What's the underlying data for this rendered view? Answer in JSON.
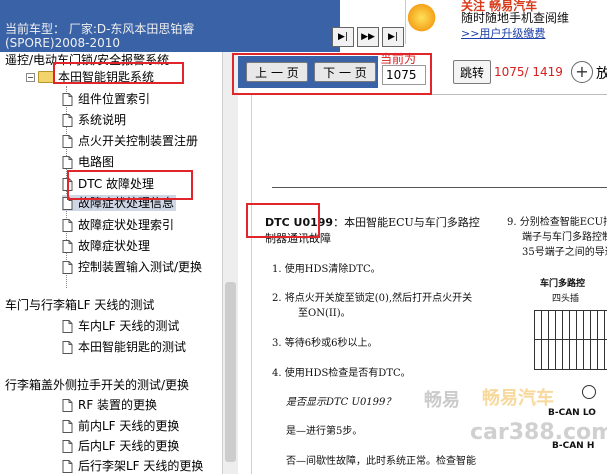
{
  "header": {
    "title_line1": "当前车型： 厂家:D-东风本田思铂睿",
    "title_line2": "(SPORE)2008-2010"
  },
  "ad": {
    "line1": "关注 畅易汽车",
    "line2": "随时随地手机查阅维",
    "line3": ">>用户升级缴费"
  },
  "tree": {
    "parent_cut": "遥控/电动车门锁/安全报警系统",
    "folder": "本田智能钥匙系统",
    "items": [
      "组件位置索引",
      "系统说明",
      "点火开关控制装置注册",
      "电路图",
      "DTC 故障处理",
      "故障症状处理信息",
      "故障症状处理索引",
      "故障症状处理",
      "控制装置输入测试/更换"
    ],
    "group2": "车门与行李箱LF 天线的测试",
    "group2_items": [
      "车内LF 天线的测试",
      "本田智能钥匙的测试"
    ],
    "group3": "行李箱盖外侧拉手开关的测试/更换",
    "group3_items": [
      "RF 装置的更换",
      "前内LF 天线的更换",
      "后内LF 天线的更换",
      "后行李架LF 天线的更换"
    ]
  },
  "toolbar": {
    "prev_label": "上 一 页",
    "next_label": "下 一 页",
    "current_label": "当前为",
    "page_value": "1075",
    "jump_label": "跳转",
    "page_count": "1075/ 1419",
    "zoom_label": "放"
  },
  "doc": {
    "dtc_code": "DTC U0199",
    "dtc_title_rest": "：本田智能ECU与车门多路控",
    "dtc_title_line2": "制器通讯故障",
    "step1": "1.  使用HDS清除DTC。",
    "step2a": "2.  将点火开关旋至锁定(0),然后打开点火开关",
    "step2b": "至ON(II)。",
    "step3": "3.  等待6秒或6秒以上。",
    "step4": "4.  使用HDS检查是否有DTC。",
    "question": "是否显示DTC U0199？",
    "yes": "是—进行第5步。",
    "no": "否—间歇性故障，此时系统正常。检查智能",
    "right9a": "9.  分别检查智能ECU插",
    "right9b": "端子与车门多路控制",
    "right9c": "35号端子之间的导通",
    "diagram_title": "车门多路控",
    "diagram_sub": "四头插",
    "bcan_lo": "B-CAN LO",
    "bcan_h": "B-CAN H"
  },
  "watermark": {
    "w1": "畅易",
    "w2": "畅易汽车",
    "w3": "car388.com"
  }
}
